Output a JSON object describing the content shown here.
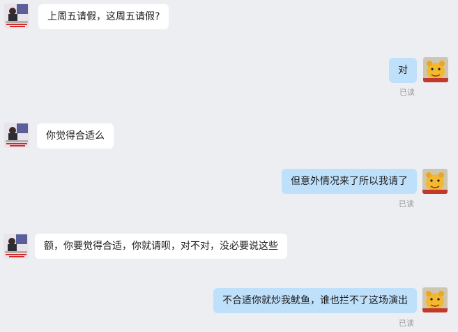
{
  "messages": [
    {
      "side": "in",
      "text": "上周五请假，这周五请假?"
    },
    {
      "side": "out",
      "text": "对",
      "status": "已读"
    },
    {
      "side": "in",
      "text": "你觉得合适么"
    },
    {
      "side": "out",
      "text": "但意外情况来了所以我请了",
      "status": "已读"
    },
    {
      "side": "in",
      "text": "额，你要觉得合适，你就请呗，对不对，没必要说这些"
    },
    {
      "side": "out",
      "text": "不合适你就炒我鱿鱼，谁也拦不了这场演出",
      "status": "已读"
    }
  ],
  "avatars": {
    "boss_icon": "man-at-desk-avatar-icon",
    "me_icon": "winnie-the-pooh-avatar-icon"
  }
}
